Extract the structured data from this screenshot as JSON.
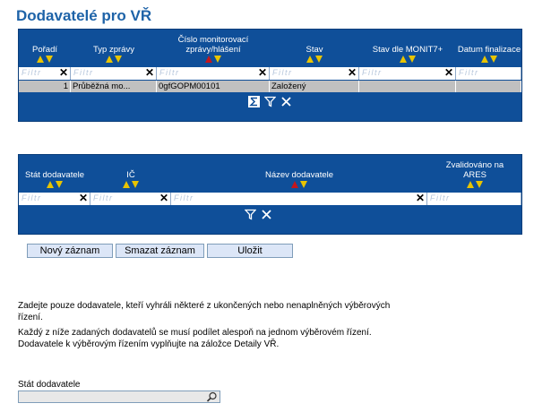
{
  "page_title": "Dodavatelé pro VŘ",
  "filter_placeholder": "Filtr",
  "grid1": {
    "headers": [
      "Pořadí",
      "Typ zprávy",
      "Číslo monitorovací zprávy/hlášení",
      "Stav",
      "Stav dle MONIT7+",
      "Datum finalizace"
    ],
    "row": [
      "1",
      "Průběžná mo...",
      "0gfGOPM00101",
      "Založený",
      "",
      ""
    ]
  },
  "grid2": {
    "headers": [
      "Stát dodavatele",
      "IČ",
      "Název dodavatele",
      "Zvalidováno na ARES"
    ]
  },
  "buttons": {
    "new": "Nový záznam",
    "delete": "Smazat záznam",
    "save": "Uložit"
  },
  "info": {
    "line1": "Zadejte pouze dodavatele, kteří vyhráli některé z ukončených nebo nenaplněných výběrových",
    "line2": "řízení.",
    "line3": "Každý z níže zadaných dodavatelů se musí podílet alespoň na jednom výběrovém řízení.",
    "line4": "Dodavatele k výběrovým řízením vyplňujte na záložce Detaily VŘ."
  },
  "field": {
    "label": "Stát dodavatele",
    "value": ""
  },
  "colors": {
    "grid_bg": "#0f4f99",
    "title": "#1e63a8",
    "sort_yellow": "#e8c400",
    "sort_red": "#c4161c",
    "row_gray": "#c0c0c0"
  }
}
